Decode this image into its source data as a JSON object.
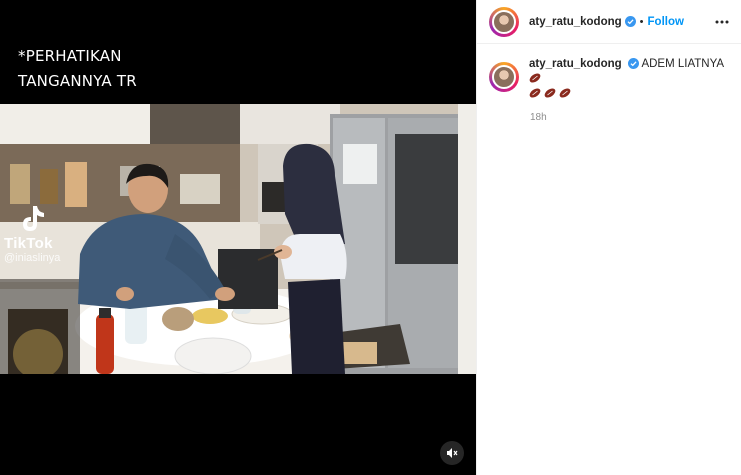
{
  "video": {
    "overlay_lines": [
      "*PERHATIKAN",
      "TANGANNYA TR"
    ],
    "watermark_brand": "TikTok",
    "watermark_handle": "@iniaslinya"
  },
  "header": {
    "username": "aty_ratu_kodong",
    "follow_label": "Follow",
    "more_icon": "more-horizontal-icon"
  },
  "caption": {
    "username": "aty_ratu_kodong",
    "text": "ADEM LIATNYA",
    "emoji": "rugby-football",
    "timestamp": "18h"
  },
  "colors": {
    "accent": "#0095f6",
    "verified": "#3897f0",
    "text": "#262626",
    "muted": "#8e8e8e"
  }
}
